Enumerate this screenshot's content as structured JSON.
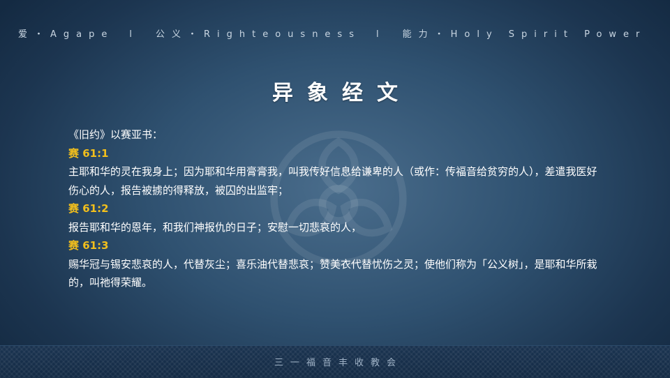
{
  "header": {
    "part1": "爱・Agape",
    "sep1": "l",
    "part2": "公义・Righteousness",
    "sep2": "l",
    "part3": "能力・Holy Spirit Power"
  },
  "title": "异象经文",
  "intro": "《旧约》以赛亚书：",
  "verses": [
    {
      "ref": "赛 61:1",
      "text": "主耶和华的灵在我身上；因为耶和华用膏膏我，叫我传好信息给谦卑的人（或作：传福音给贫穷的人），差遣我医好伤心的人，报告被掳的得释放，被囚的出监牢；"
    },
    {
      "ref": "赛 61:2",
      "text": "报告耶和华的恩年，和我们神报仇的日子；安慰一切悲哀的人，"
    },
    {
      "ref": "赛 61:3",
      "text": "赐华冠与锡安悲哀的人，代替灰尘；喜乐油代替悲哀；赞美衣代替忧伤之灵；使他们称为「公义树」，是耶和华所栽的，叫祂得荣耀。"
    }
  ],
  "footer": "三一福音丰收教会"
}
